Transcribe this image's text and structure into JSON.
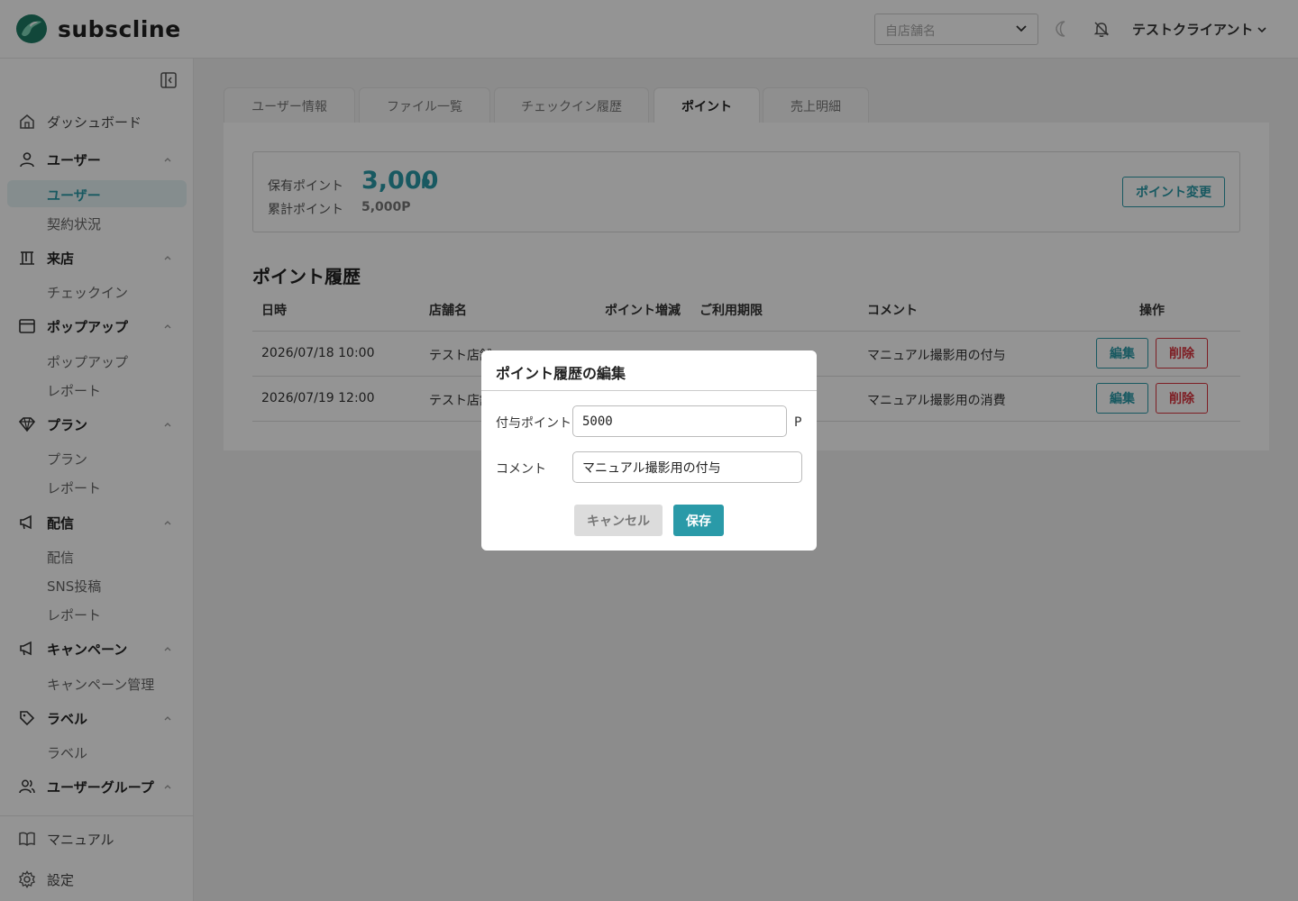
{
  "header": {
    "logo_text": "subscline",
    "store_select_placeholder": "自店舗名",
    "client_name": "テストクライアント"
  },
  "sidebar": {
    "dashboard": "ダッシュボード",
    "groups": [
      {
        "label": "ユーザー",
        "icon": "user-icon",
        "items": [
          "ユーザー",
          "契約状況"
        ]
      },
      {
        "label": "来店",
        "icon": "store-icon",
        "items": [
          "チェックイン"
        ]
      },
      {
        "label": "ポップアップ",
        "icon": "window-icon",
        "items": [
          "ポップアップ",
          "レポート"
        ]
      },
      {
        "label": "プラン",
        "icon": "diamond-icon",
        "items": [
          "プラン",
          "レポート"
        ]
      },
      {
        "label": "配信",
        "icon": "megaphone-icon",
        "items": [
          "配信",
          "SNS投稿",
          "レポート"
        ]
      },
      {
        "label": "キャンペーン",
        "icon": "megaphone-icon",
        "items": [
          "キャンペーン管理"
        ]
      },
      {
        "label": "ラベル",
        "icon": "tag-icon",
        "items": [
          "ラベル"
        ]
      },
      {
        "label": "ユーザーグループ",
        "icon": "users-icon",
        "items": []
      }
    ],
    "manual": "マニュアル",
    "settings": "設定"
  },
  "tabs": [
    "ユーザー情報",
    "ファイル一覧",
    "チェックイン履歴",
    "ポイント",
    "売上明細"
  ],
  "active_tab": "ポイント",
  "points": {
    "held_label": "保有ポイント",
    "held_value": "3,000",
    "held_unit": "P",
    "total_label": "累計ポイント",
    "total_value": "5,000P",
    "change_button": "ポイント変更"
  },
  "history": {
    "title": "ポイント履歴",
    "columns": [
      "日時",
      "店舗名",
      "ポイント増減",
      "ご利用期限",
      "コメント",
      "操作"
    ],
    "rows": [
      {
        "datetime": "2026/07/18 10:00",
        "store": "テスト店舗",
        "comment": "マニュアル撮影用の付与"
      },
      {
        "datetime": "2026/07/19 12:00",
        "store": "テスト店舗",
        "comment": "マニュアル撮影用の消費"
      }
    ],
    "edit_label": "編集",
    "delete_label": "削除"
  },
  "modal": {
    "title": "ポイント履歴の編集",
    "points_label": "付与ポイント",
    "points_value": "5000",
    "points_unit": "P",
    "comment_label": "コメント",
    "comment_value": "マニュアル撮影用の付与",
    "cancel_label": "キャンセル",
    "save_label": "保存"
  },
  "colors": {
    "accent": "#2a9aa8",
    "danger": "#d9343e",
    "overlay": "rgba(0,0,0,0.42)"
  }
}
